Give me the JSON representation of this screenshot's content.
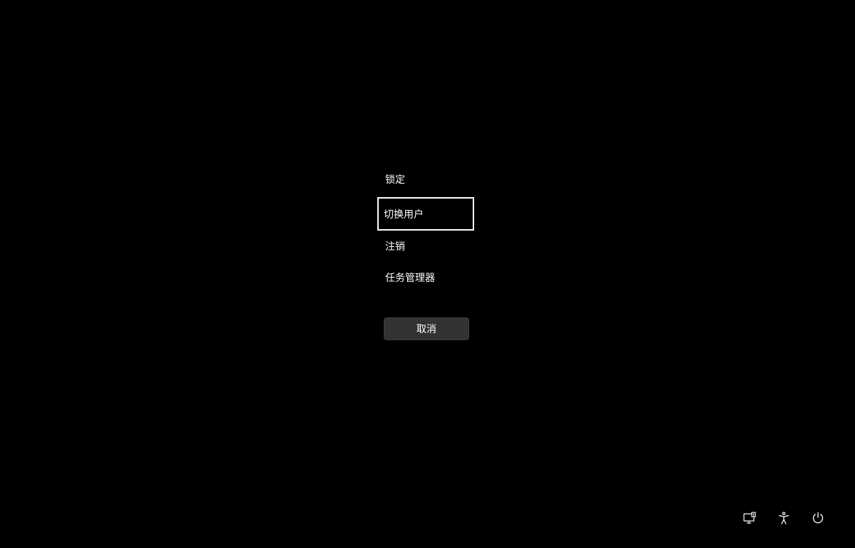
{
  "menu": {
    "items": [
      {
        "label": "锁定",
        "focused": false
      },
      {
        "label": "切换用户",
        "focused": true
      },
      {
        "label": "注销",
        "focused": false
      },
      {
        "label": "任务管理器",
        "focused": false
      }
    ]
  },
  "cancel": {
    "label": "取消"
  },
  "system_icons": [
    {
      "name": "network-icon"
    },
    {
      "name": "accessibility-icon"
    },
    {
      "name": "power-icon"
    }
  ],
  "colors": {
    "background": "#000000",
    "text": "#ffffff",
    "button_bg": "#333333",
    "focus_border": "#ffffff"
  }
}
